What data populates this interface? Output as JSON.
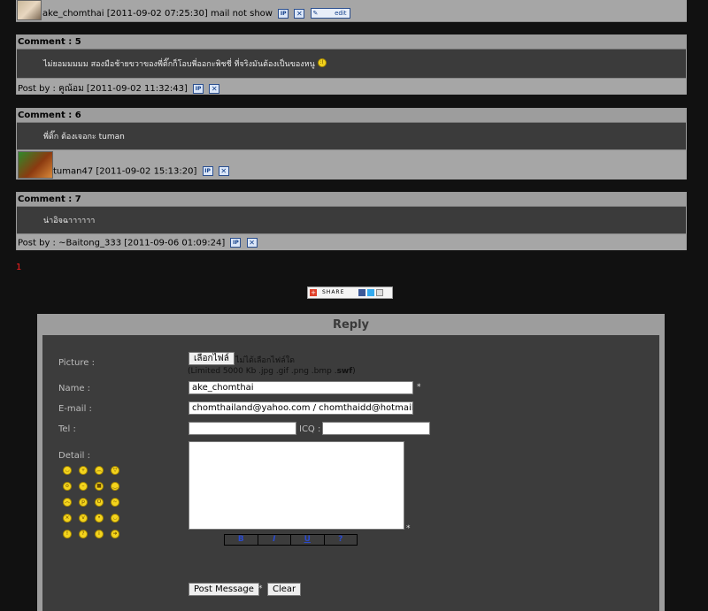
{
  "top_post": {
    "author": "ake_chomthai",
    "timestamp": "[2011-09-02 07:25:30]",
    "email_note": "mail not show",
    "edit_label": "edit"
  },
  "comments": [
    {
      "header": "Comment : 5",
      "body": "ไม่ยอมมมมม สองมือช้ายขวาของพี่ติ๊กก็โอบพี่ออกะพิชชี่ ที่จริงมันต้องเป็นของหนู",
      "footer": "Post by : คูณ้อม [2011-09-02 11:32:43]"
    },
    {
      "header": "Comment : 6",
      "body": "พี่ติ๊ก ต้องเจอกะ tuman",
      "footer": "tuman47 [2011-09-02 15:13:20]"
    },
    {
      "header": "Comment : 7",
      "body": "น่าอิจฉาาาาาา",
      "footer": "Post by : ~Baitong_333 [2011-09-06 01:09:24]"
    }
  ],
  "pagination": {
    "page": "1"
  },
  "share": {
    "label": "SHARE"
  },
  "reply": {
    "title": "Reply",
    "picture_label": "Picture :",
    "file_button": "เลือกไฟล์",
    "file_status": "ไม่ได้เลือกไฟล์ใด",
    "file_hint_prefix": "(Limited 5000 Kb .jpg .gif .png .bmp .",
    "file_hint_bold": "swf",
    "file_hint_suffix": ")",
    "name_label": "Name :",
    "name_value": "ake_chomthai",
    "email_label": "E-mail :",
    "email_value": "chomthailand@yahoo.com / chomthaidd@hotmail.com",
    "tel_label": "Tel :",
    "icq_label": "ICQ :",
    "detail_label": "Detail :",
    "required_mark": "*",
    "format_buttons": [
      "B",
      "I",
      "U",
      "?"
    ],
    "smilies": [
      "happy",
      "grin",
      "sad",
      "laugh",
      "surprised",
      "neutral",
      "cool",
      "wink",
      "angry",
      "tongue",
      "shocked",
      "worried",
      "mad",
      "evil",
      "blush",
      "smile",
      "exclaim",
      "question",
      "idea",
      "arrow"
    ],
    "post_button": "Post Message",
    "clear_button": "Clear"
  }
}
